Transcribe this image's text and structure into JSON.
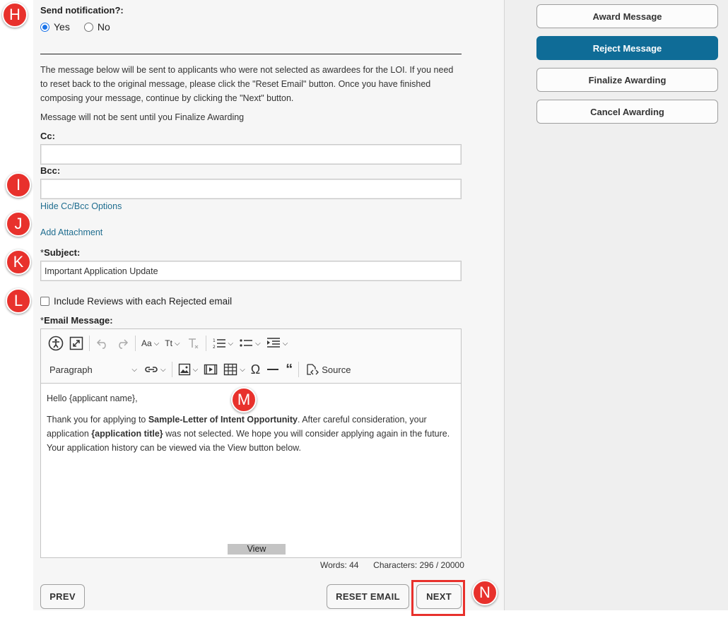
{
  "notification": {
    "label": "Send notification?:",
    "yes": "Yes",
    "no": "No"
  },
  "info": {
    "message": "The message below will be sent to applicants who were not selected as awardees for the LOI. If you need to reset back to the original message, please click the \"Reset Email\" button. Once you have finished composing your message, continue by clicking the \"Next\" button.",
    "note": "Message will not be sent until you Finalize Awarding"
  },
  "fields": {
    "cc_label": "Cc:",
    "cc_value": "",
    "bcc_label": "Bcc:",
    "bcc_value": "",
    "hide_cc_bcc": "Hide Cc/Bcc Options",
    "add_attachment": "Add Attachment",
    "subject_label": "Subject:",
    "subject_value": "Important Application Update",
    "include_reviews": "Include Reviews with each Rejected email",
    "email_message_label": "Email Message:",
    "required_mark": "*"
  },
  "toolbar": {
    "font_size_icon": "Aa",
    "case_icon": "Tt",
    "heading_select": "Paragraph",
    "source_label": "Source"
  },
  "email": {
    "greeting": "Hello {applicant name},",
    "p1_a": "Thank you for applying to ",
    "p1_bold": "Sample-Letter of Intent Opportunity",
    "p1_b": ". After careful consideration, your application ",
    "p1_bold2": "{application title}",
    "p1_c": " was not selected. We hope you will consider applying again in the future. Your application history can be viewed via the View button below.",
    "view_button": "View"
  },
  "counter": {
    "words": "Words: 44",
    "characters": "Characters: 296 / 20000"
  },
  "footer": {
    "prev": "PREV",
    "reset": "RESET EMAIL",
    "next": "NEXT"
  },
  "sidebar": {
    "items": [
      {
        "label": "Award Message",
        "active": false
      },
      {
        "label": "Reject Message",
        "active": true
      },
      {
        "label": "Finalize Awarding",
        "active": false
      },
      {
        "label": "Cancel Awarding",
        "active": false
      }
    ]
  },
  "markers": {
    "h": "H",
    "i": "I",
    "j": "J",
    "k": "K",
    "l": "L",
    "m": "M",
    "n": "N"
  },
  "colors": {
    "accent": "#0f6c97",
    "link": "#1f6d8f",
    "marker": "#e8312c"
  }
}
